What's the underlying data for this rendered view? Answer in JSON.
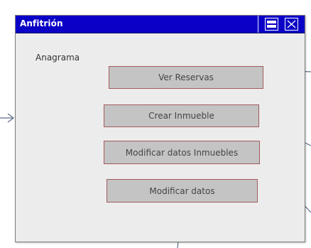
{
  "window": {
    "title": "Anfitrión",
    "app_label": "Anagrama"
  },
  "buttons": {
    "ver_reservas": "Ver Reservas",
    "crear_inmueble": "Crear Inmueble",
    "modificar_datos_inmuebles": "Modificar datos Inmuebles",
    "modificar_datos": "Modificar datos"
  },
  "colors": {
    "titlebar": "#0a00c6",
    "window_background": "#ececec",
    "button_fill": "#c4c4c4",
    "button_border": "#a25b5b",
    "connector": "#5f6b8a"
  },
  "icons": [
    "maximize-icon",
    "close-icon",
    "incoming-arrow-icon"
  ]
}
